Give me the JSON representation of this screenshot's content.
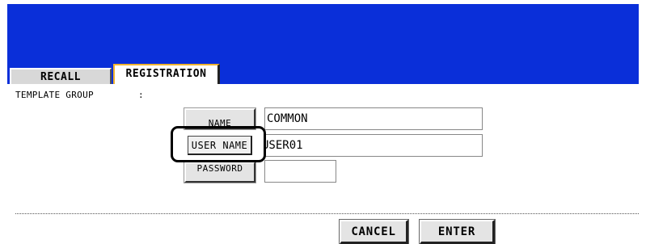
{
  "tabs": [
    {
      "label": "RECALL",
      "active": false
    },
    {
      "label": "REGISTRATION",
      "active": true
    }
  ],
  "template_group": {
    "label": "TEMPLATE GROUP",
    "separator": ":"
  },
  "fields": {
    "name": {
      "button_label": "NAME",
      "value": "COMMON"
    },
    "user_name": {
      "button_label": "USER NAME",
      "value": "USER01"
    },
    "password": {
      "button_label": "PASSWORD",
      "value": ""
    }
  },
  "actions": {
    "cancel_label": "CANCEL",
    "enter_label": "ENTER"
  },
  "colors": {
    "header": "#0a2fd9",
    "active_tab_accent": "#f0b430",
    "button_face": "#e4e4e4"
  }
}
